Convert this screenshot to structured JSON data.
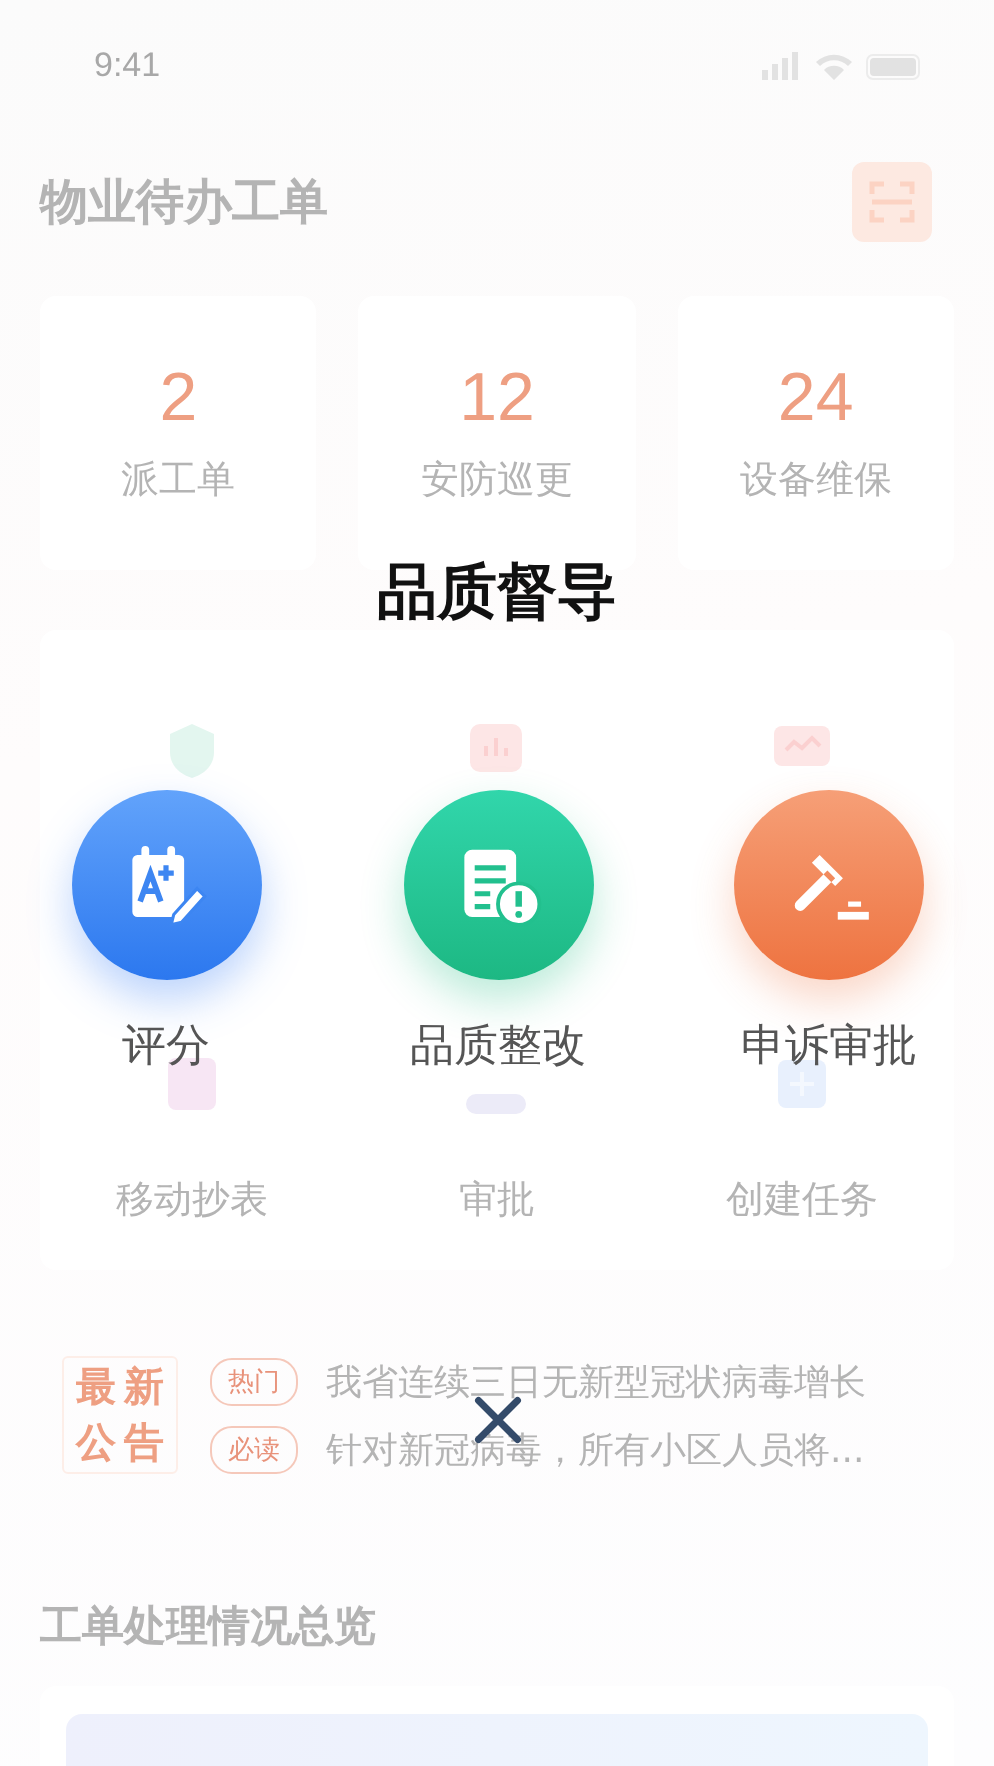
{
  "status_bar": {
    "time": "9:41"
  },
  "background": {
    "title": "物业待办工单",
    "stats": [
      {
        "value": "2",
        "label": "派工单"
      },
      {
        "value": "12",
        "label": "安防巡更"
      },
      {
        "value": "24",
        "label": "设备维保"
      }
    ],
    "shortcuts": [
      {
        "label": "移动抄表"
      },
      {
        "label": "审批"
      },
      {
        "label": "创建任务"
      }
    ],
    "notice_badge": "最新公告",
    "notices": [
      {
        "tag": "热门",
        "text": "我省连续三日无新型冠状病毒增长"
      },
      {
        "tag": "必读",
        "text": "针对新冠病毒，所有小区人员将..."
      }
    ],
    "section_title": "工单处理情况总览"
  },
  "modal": {
    "title": "品质督导",
    "actions": [
      {
        "kind": "score",
        "label": "评分"
      },
      {
        "kind": "rectify",
        "label": "品质整改"
      },
      {
        "kind": "appeal",
        "label": "申诉审批"
      }
    ]
  }
}
